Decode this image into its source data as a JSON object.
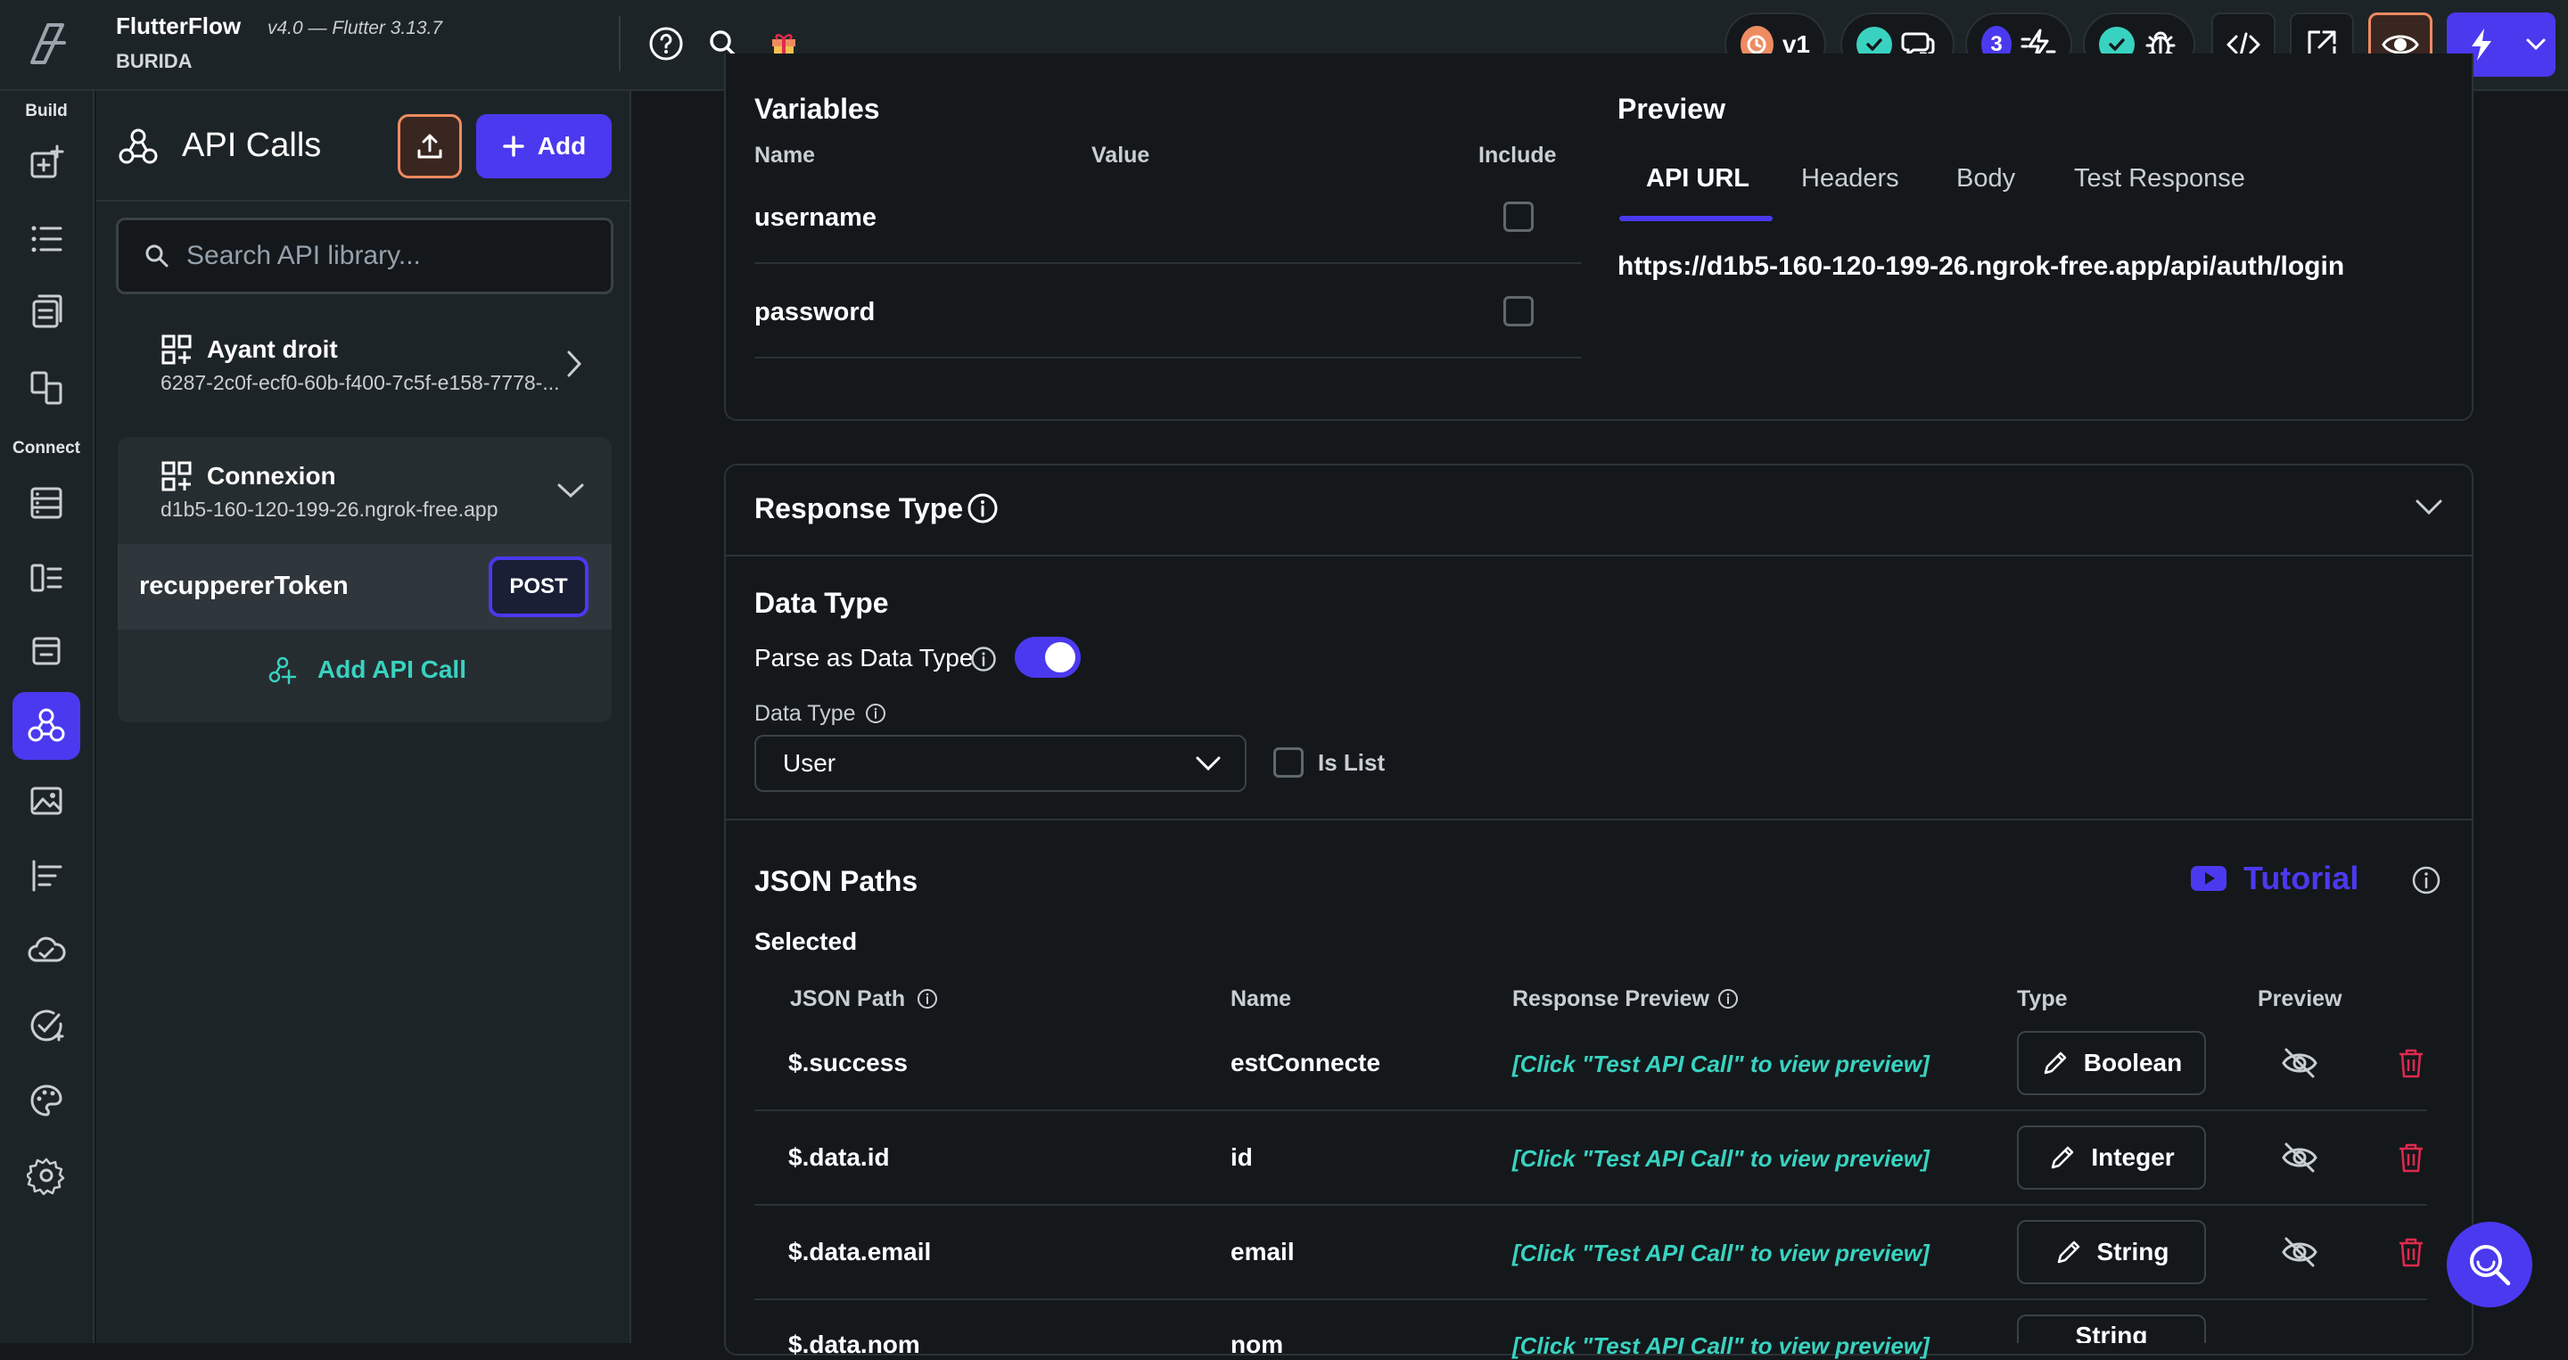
{
  "app": {
    "name": "FlutterFlow",
    "version": "v4.0 — Flutter 3.13.7",
    "project": "BURIDA"
  },
  "topbar": {
    "icons": [
      "help-icon",
      "search-icon",
      "gift-icon"
    ],
    "version_badge": "v1",
    "notifications_count": "3"
  },
  "rail": {
    "sections": {
      "build": "Build",
      "connect": "Connect"
    },
    "icons": [
      "add-widget-icon",
      "list-icon",
      "storyboard-icon",
      "page-selector-icon",
      "database-icon",
      "app-state-icon",
      "media-icon",
      "api-icon",
      "image-icon",
      "logs-icon",
      "cloud-icon",
      "test-icon",
      "theme-icon",
      "settings-icon"
    ]
  },
  "panel": {
    "title": "API Calls",
    "add_label": "Add",
    "search_placeholder": "Search API library...",
    "groups": [
      {
        "name": "Ayant droit",
        "url": "6287-2c0f-ecf0-60b-f400-7c5f-e158-7778-..."
      },
      {
        "name": "Connexion",
        "url": "d1b5-160-120-199-26.ngrok-free.app"
      }
    ],
    "call": {
      "name": "recuppererToken",
      "method": "POST"
    },
    "add_call_label": "Add API Call"
  },
  "variables": {
    "title": "Variables",
    "headers": {
      "name": "Name",
      "value": "Value",
      "include": "Include"
    },
    "rows": [
      {
        "name": "username"
      },
      {
        "name": "password"
      }
    ]
  },
  "preview": {
    "title": "Preview",
    "tabs": [
      "API URL",
      "Headers",
      "Body",
      "Test Response"
    ],
    "active_tab": "API URL",
    "url": "https://d1b5-160-120-199-26.ngrok-free.app/api/auth/login"
  },
  "response_type": {
    "title": "Response Type"
  },
  "data_type": {
    "title": "Data Type",
    "parse_label": "Parse as Data Type",
    "parse_enabled": true,
    "field_label": "Data Type",
    "selected": "User",
    "is_list_label": "Is List"
  },
  "json_paths": {
    "title": "JSON Paths",
    "tutorial_label": "Tutorial",
    "selected_label": "Selected",
    "headers": {
      "path": "JSON Path",
      "name": "Name",
      "preview": "Response Preview",
      "type": "Type",
      "preview_col": "Preview"
    },
    "rows": [
      {
        "path": "$.success",
        "name": "estConnecte",
        "preview": "[Click \"Test API Call\" to view preview]",
        "type": "Boolean"
      },
      {
        "path": "$.data.id",
        "name": "id",
        "preview": "[Click \"Test API Call\" to view preview]",
        "type": "Integer"
      },
      {
        "path": "$.data.email",
        "name": "email",
        "preview": "[Click \"Test API Call\" to view preview]",
        "type": "String"
      },
      {
        "path": "$.data.nom",
        "name": "nom",
        "preview": "[Click \"Test API Call\" to view preview]",
        "type": "String"
      }
    ]
  },
  "colors": {
    "accent": "#4b39ef",
    "teal": "#39d2c0",
    "orange": "#ee8b60",
    "danger": "#e0294e",
    "bg": "#14181b",
    "surface": "#1d2428"
  }
}
